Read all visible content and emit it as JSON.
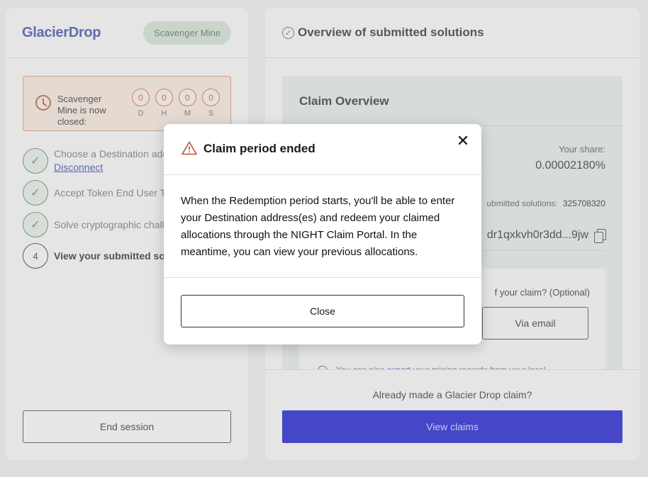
{
  "left": {
    "logo": "GlacierDrop",
    "pill": "Scavenger Mine",
    "closed_text": "Scavenger Mine is now closed:",
    "countdown": [
      {
        "value": "0",
        "label": "D"
      },
      {
        "value": "0",
        "label": "H"
      },
      {
        "value": "0",
        "label": "M"
      },
      {
        "value": "0",
        "label": "S"
      }
    ],
    "steps": [
      {
        "text": "Choose a Destination add",
        "link": "Disconnect",
        "done": true
      },
      {
        "text": "Accept Token End User Te",
        "done": true
      },
      {
        "text": "Solve cryptographic chall",
        "done": true
      },
      {
        "number": "4",
        "text": "View your submitted solu",
        "done": false
      }
    ],
    "end_session": "End session"
  },
  "right": {
    "title": "Overview of submitted solutions",
    "claim_title": "Claim Overview",
    "share_label": "Your share:",
    "share_value": "0.00002180%",
    "submitted_label": "ubmitted solutions:",
    "submitted_value": "325708320",
    "address": "dr1qxkvh0r3dd...9jw",
    "notify_question": "f your claim? (Optional)",
    "email_button": "Via email",
    "export_prefix": "You can also ",
    "export_link": "export",
    "export_suffix": " your mining records from your local",
    "already_claim": "Already made a Glacier Drop claim?",
    "view_claims": "View claims"
  },
  "modal": {
    "title": "Claim period ended",
    "body": "When the Redemption period starts, you'll be able to enter your Destination address(es) and redeem your claimed allocations through the NIGHT Claim Portal. In the meantime, you can view your previous allocations.",
    "close_button": "Close"
  },
  "colors": {
    "accent_blue": "#0000c8",
    "logo_blue": "#2b3aa0",
    "warning": "#a0502a",
    "success": "#4d7a57"
  }
}
